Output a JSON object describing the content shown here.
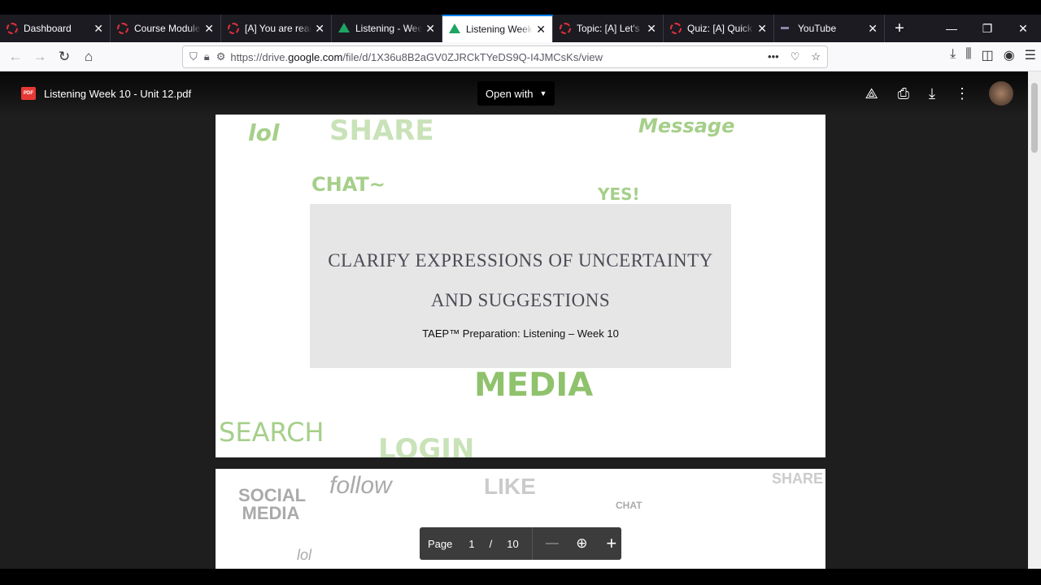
{
  "tabs": [
    {
      "label": "Dashboard",
      "icon": "moodle-icon",
      "active": false
    },
    {
      "label": "Course Modules",
      "icon": "moodle-icon",
      "active": false
    },
    {
      "label": "[A] You are ready",
      "icon": "moodle-icon",
      "active": false
    },
    {
      "label": "Listening - Week",
      "icon": "google-drive-icon",
      "active": false
    },
    {
      "label": "Listening Week",
      "icon": "google-drive-icon",
      "active": true
    },
    {
      "label": "Topic: [A] Let's",
      "icon": "moodle-icon",
      "active": false
    },
    {
      "label": "Quiz: [A] Quick",
      "icon": "moodle-icon",
      "active": false
    },
    {
      "label": "YouTube",
      "icon": "youtube-icon",
      "active": false
    }
  ],
  "address": {
    "prefix": "https://drive.",
    "domain": "google.com",
    "path": "/file/d/1X36u8B2aGV0ZJRCkTYeDS9Q-I4JMCsKs/view"
  },
  "viewer": {
    "file_name": "Listening Week 10 - Unit 12.pdf",
    "open_with": "Open with",
    "pdf_badge": "PDF"
  },
  "slide": {
    "title_line1": "CLARIFY EXPRESSIONS OF UNCERTAINTY",
    "title_line2": "AND SUGGESTIONS",
    "subtitle": "TAEP™ Preparation: Listening – Week 10",
    "artwork_words": [
      "lol",
      "SHARE",
      "Message",
      "CHAT~",
      "YES!",
      "MEDIA",
      "SEARCH",
      "LOGIN"
    ]
  },
  "slide2": {
    "artwork_words": [
      "SOCIAL MEDIA",
      "follow",
      "LIKE",
      "CHAT",
      "SHARE",
      "lol"
    ]
  },
  "page_controls": {
    "page_label": "Page",
    "current": "1",
    "separator": "/",
    "total": "10"
  },
  "colors": {
    "accent": "#0a84ff",
    "artwork_green": "#a6cf8a"
  }
}
